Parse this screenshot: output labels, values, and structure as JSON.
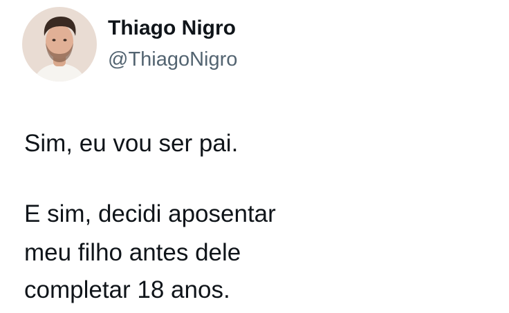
{
  "author": {
    "display_name": "Thiago Nigro",
    "handle": "@ThiagoNigro",
    "avatar_icon": "profile-photo-icon"
  },
  "tweet": {
    "lines": [
      "Sim, eu vou ser pai.",
      "E sim, decidi aposentar",
      "meu filho antes dele",
      "completar 18 anos."
    ]
  },
  "colors": {
    "background": "#ffffff",
    "text_primary": "#0f1419",
    "text_secondary": "#536471"
  }
}
